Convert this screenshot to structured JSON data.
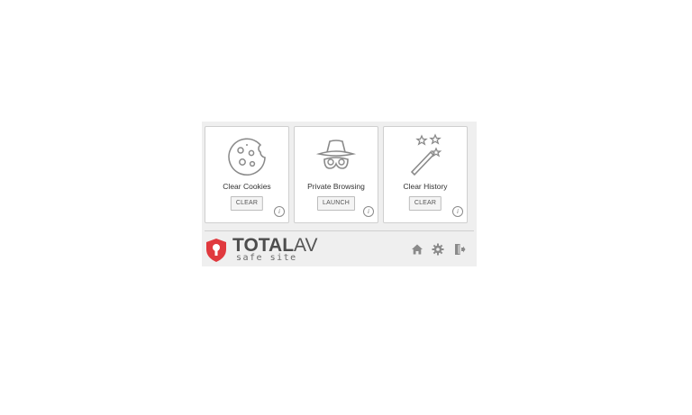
{
  "cards": [
    {
      "label": "Clear Cookies",
      "button": "CLEAR",
      "icon": "cookie-icon"
    },
    {
      "label": "Private Browsing",
      "button": "LAUNCH",
      "icon": "incognito-icon"
    },
    {
      "label": "Clear History",
      "button": "CLEAR",
      "icon": "magic-wand-icon"
    }
  ],
  "info_glyph": "i",
  "footer": {
    "brand_bold": "TOTAL",
    "brand_light": "AV",
    "tagline": "safe site",
    "icons": [
      "home-icon",
      "gear-icon",
      "logout-icon"
    ]
  },
  "colors": {
    "shield": "#e0393e",
    "icon_gray": "#8a8a8a",
    "panel_bg": "#efefef"
  }
}
